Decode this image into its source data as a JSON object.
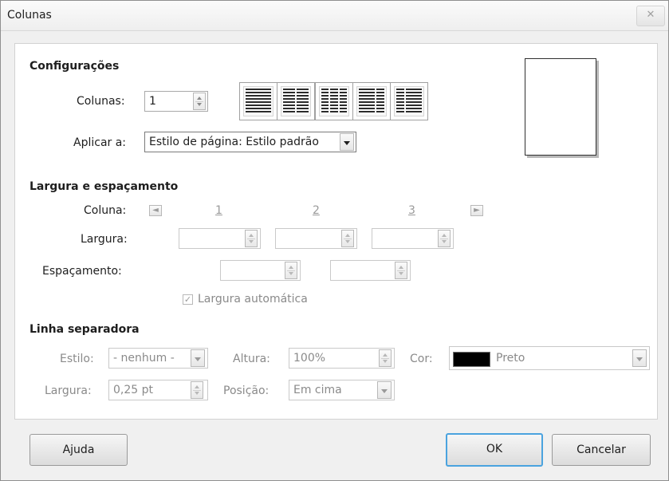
{
  "window": {
    "title": "Colunas",
    "close_icon": "close-icon"
  },
  "settings": {
    "heading": "Configurações",
    "columns_label": "Colunas:",
    "columns_value": "1",
    "apply_label": "Aplicar a:",
    "apply_value": "Estilo de página: Estilo padrão"
  },
  "width_spacing": {
    "heading": "Largura e espaçamento",
    "column_label": "Coluna:",
    "column_numbers": [
      "1",
      "2",
      "3"
    ],
    "width_label": "Largura:",
    "spacing_label": "Espaçamento:",
    "auto_width_label": "Largura automática",
    "auto_width_checked": true
  },
  "separator": {
    "heading": "Linha separadora",
    "style_label": "Estilo:",
    "style_value": "- nenhum -",
    "height_label": "Altura:",
    "height_value": "100%",
    "color_label": "Cor:",
    "color_value": "Preto",
    "color_hex": "#000000",
    "width_label": "Largura:",
    "width_value": "0,25 pt",
    "position_label": "Posição:",
    "position_value": "Em cima"
  },
  "buttons": {
    "help": "Ajuda",
    "ok": "OK",
    "cancel": "Cancelar"
  }
}
